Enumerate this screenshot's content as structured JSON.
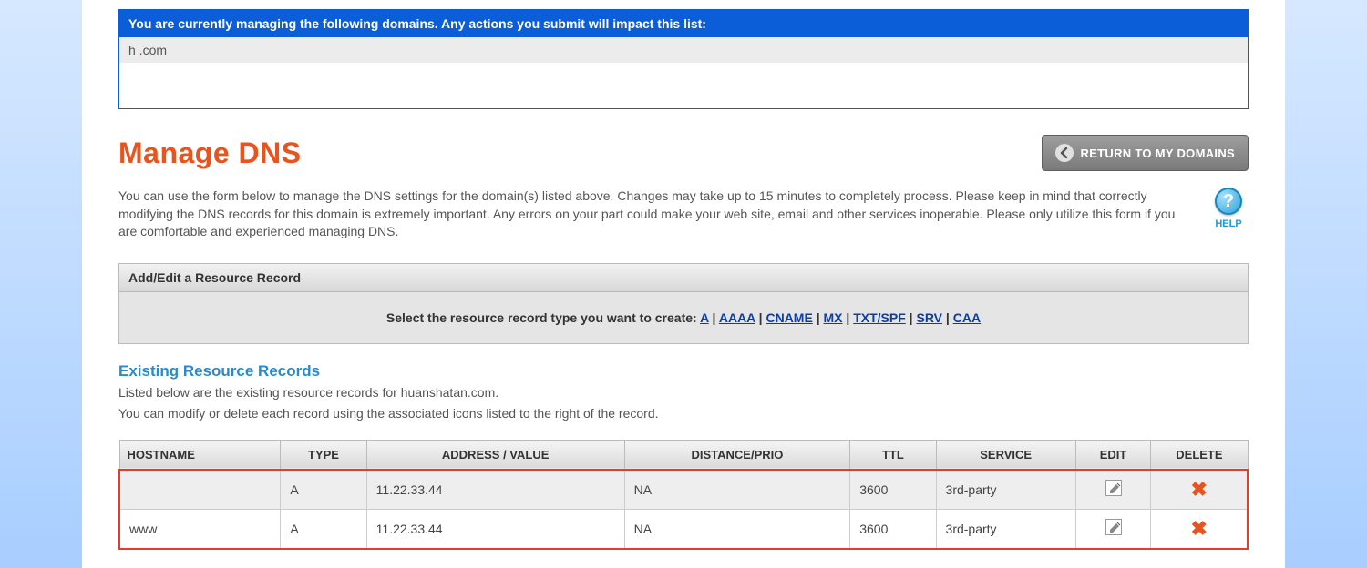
{
  "notice": {
    "header": "You are currently managing the following domains. Any actions you submit will impact this list:",
    "domain": "h                .com"
  },
  "header": {
    "title": "Manage DNS",
    "return_label": "RETURN TO MY DOMAINS"
  },
  "description": "You can use the form below to manage the DNS settings for the domain(s) listed above. Changes may take up to 15 minutes to completely process. Please keep in mind that correctly modifying the DNS records for this domain is extremely important. Any errors on your part could make your web site, email and other services inoperable. Please only utilize this form if you are comfortable and experienced managing DNS.",
  "help": {
    "label": "HELP"
  },
  "add_panel": {
    "title": "Add/Edit a Resource Record",
    "prompt": "Select the resource record type you want to create: ",
    "types": [
      "A",
      "AAAA",
      "CNAME",
      "MX",
      "TXT/SPF",
      "SRV",
      "CAA"
    ]
  },
  "existing": {
    "title": "Existing Resource Records",
    "sub1": "Listed below are the existing resource records for huanshatan.com.",
    "sub2": "You can modify or delete each record using the associated icons listed to the right of the record."
  },
  "table": {
    "headers": {
      "hostname": "HOSTNAME",
      "type": "TYPE",
      "address": "ADDRESS / VALUE",
      "distance": "DISTANCE/PRIO",
      "ttl": "TTL",
      "service": "SERVICE",
      "edit": "EDIT",
      "delete": "DELETE"
    },
    "rows": [
      {
        "hostname": "",
        "type": "A",
        "address": "11.22.33.44",
        "distance": "NA",
        "ttl": "3600",
        "service": "3rd-party"
      },
      {
        "hostname": "www",
        "type": "A",
        "address": "11.22.33.44",
        "distance": "NA",
        "ttl": "3600",
        "service": "3rd-party"
      }
    ]
  }
}
